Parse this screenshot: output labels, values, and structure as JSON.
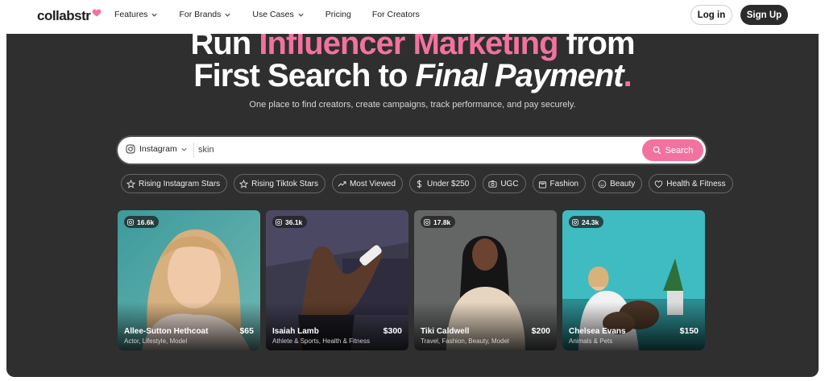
{
  "nav": {
    "logo": "collabstr",
    "links": [
      {
        "label": "Features",
        "has_dropdown": true
      },
      {
        "label": "For Brands",
        "has_dropdown": true
      },
      {
        "label": "Use Cases",
        "has_dropdown": true
      },
      {
        "label": "Pricing",
        "has_dropdown": false
      },
      {
        "label": "For Creators",
        "has_dropdown": false
      }
    ],
    "login": "Log in",
    "signup": "Sign Up"
  },
  "hero": {
    "line1_a": "Run ",
    "line1_b": "Influencer Marketing",
    "line1_c": " from",
    "line2_a": "First Search to ",
    "line2_b": "Final Payment",
    "line2_c": ".",
    "subheading": "One place to find creators, create campaigns, track performance, and pay securely."
  },
  "search": {
    "platform": "Instagram",
    "value": "skin",
    "button": "Search"
  },
  "chips": [
    {
      "label": "Rising Instagram Stars",
      "icon": "star-icon"
    },
    {
      "label": "Rising Tiktok Stars",
      "icon": "star-icon"
    },
    {
      "label": "Most Viewed",
      "icon": "trending-icon"
    },
    {
      "label": "Under $250",
      "icon": "dollar-icon"
    },
    {
      "label": "UGC",
      "icon": "camera-icon"
    },
    {
      "label": "Fashion",
      "icon": "shopping-bag-icon"
    },
    {
      "label": "Beauty",
      "icon": "smile-icon"
    },
    {
      "label": "Health & Fitness",
      "icon": "heart-icon"
    }
  ],
  "cards": [
    {
      "followers": "16.6k",
      "name": "Allee-Sutton Hethcoat",
      "tags": "Actor, Lifestyle, Model",
      "price": "$65"
    },
    {
      "followers": "36.1k",
      "name": "Isaiah Lamb",
      "tags": "Athlete & Sports, Health & Fitness",
      "price": "$300"
    },
    {
      "followers": "17.8k",
      "name": "Tiki Caldwell",
      "tags": "Travel, Fashion, Beauty, Model",
      "price": "$200"
    },
    {
      "followers": "24.3k",
      "name": "Chelsea Evans",
      "tags": "Animals & Pets",
      "price": "$150"
    }
  ],
  "colors": {
    "accent": "#f2729f",
    "hero_bg": "#2f2f2f",
    "dark_button": "#2b2b2b"
  }
}
